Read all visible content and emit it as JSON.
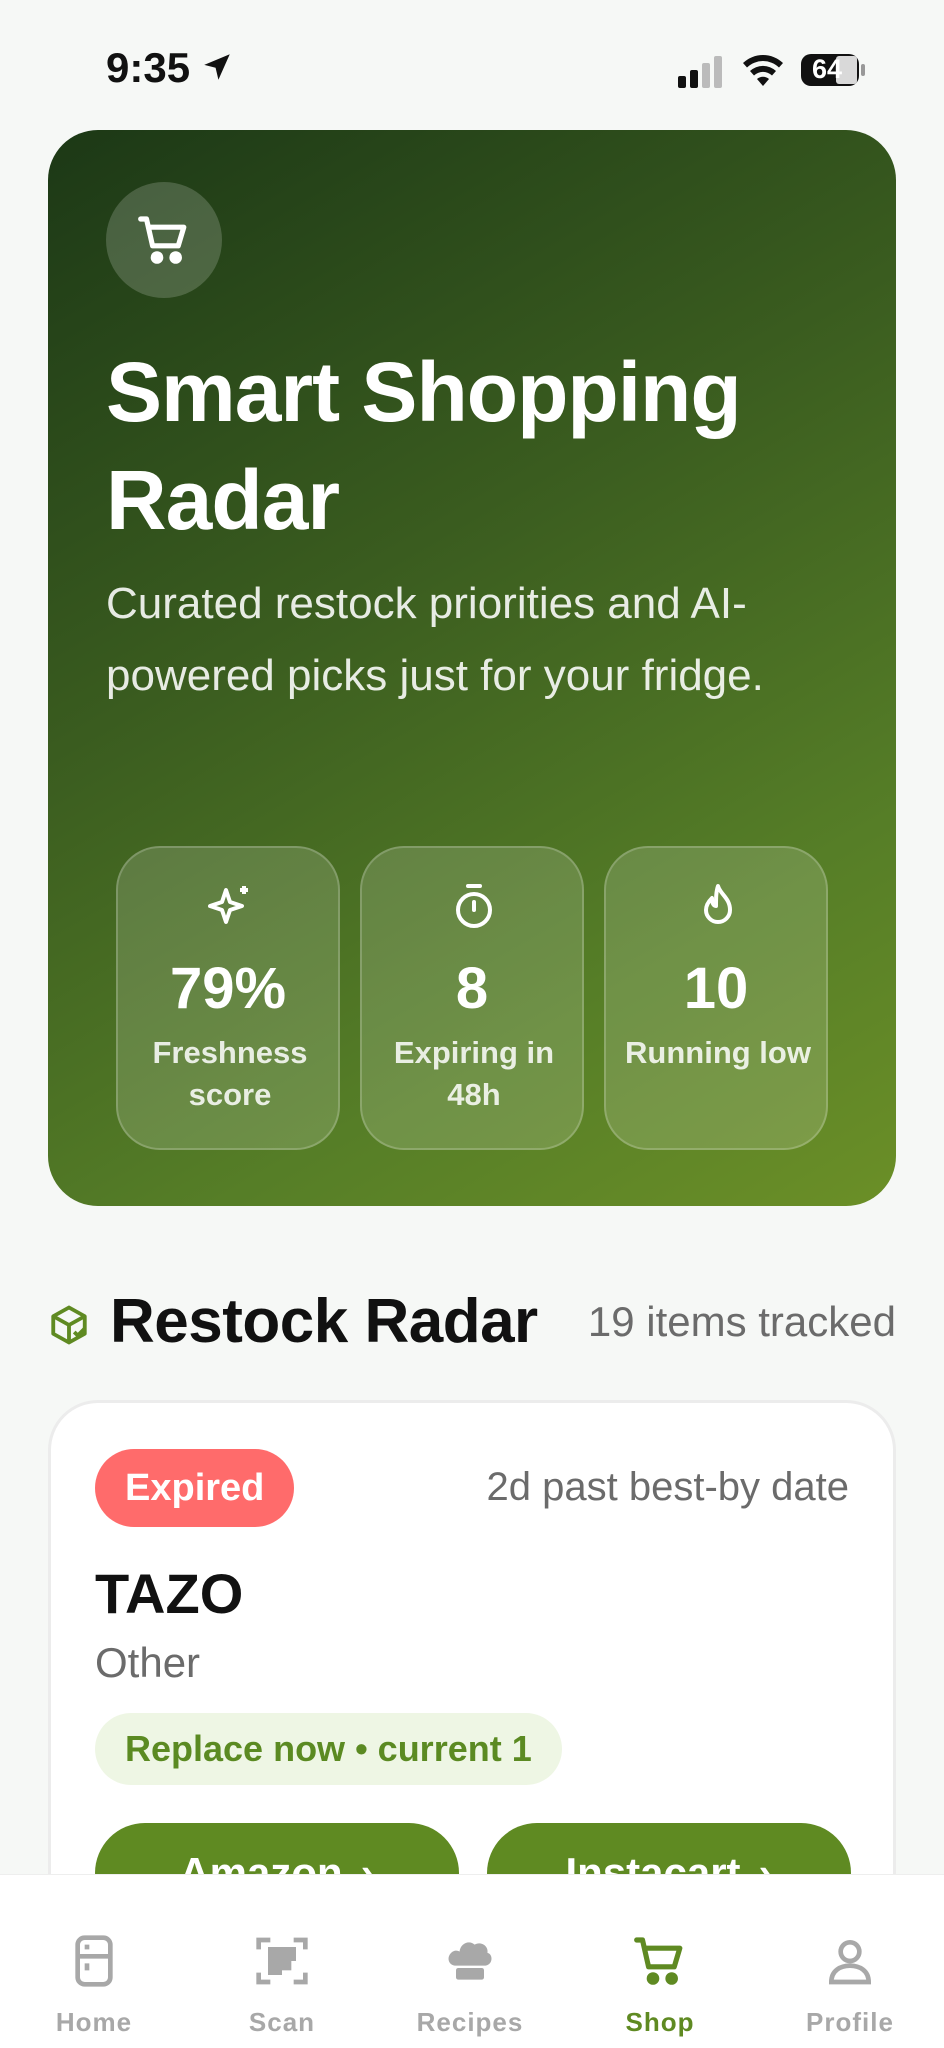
{
  "status_bar": {
    "time": "9:35",
    "battery": "64"
  },
  "hero": {
    "icon": "cart-icon",
    "title": "Smart Shopping Radar",
    "subtitle": "Curated restock priorities and AI-powered picks just for your fridge.",
    "stats": [
      {
        "icon": "sparkles-icon",
        "value": "79%",
        "label": "Freshness score"
      },
      {
        "icon": "timer-icon",
        "value": "8",
        "label": "Expiring in 48h"
      },
      {
        "icon": "flame-icon",
        "value": "10",
        "label": "Running low"
      }
    ],
    "gradient_colors": [
      "#1c3816",
      "#6b8f27"
    ]
  },
  "restock": {
    "icon": "package-check-icon",
    "title": "Restock Radar",
    "count": "19 items tracked"
  },
  "item": {
    "badge": "Expired",
    "badge_color": "#ff6b6b",
    "date_note": "2d past best-by date",
    "name": "TAZO",
    "category": "Other",
    "action": "Replace now • current 1",
    "buttons": [
      {
        "label": "Amazon"
      },
      {
        "label": "Instacart"
      }
    ]
  },
  "tabs": [
    {
      "icon": "fridge-icon",
      "label": "Home",
      "active": false
    },
    {
      "icon": "qr-scan-icon",
      "label": "Scan",
      "active": false
    },
    {
      "icon": "chef-hat-icon",
      "label": "Recipes",
      "active": false
    },
    {
      "icon": "cart-icon",
      "label": "Shop",
      "active": true
    },
    {
      "icon": "user-icon",
      "label": "Profile",
      "active": false
    }
  ],
  "colors": {
    "accent": "#5f8a22",
    "tab_inactive": "#a8a8a8",
    "background": "#f6f8f6"
  }
}
